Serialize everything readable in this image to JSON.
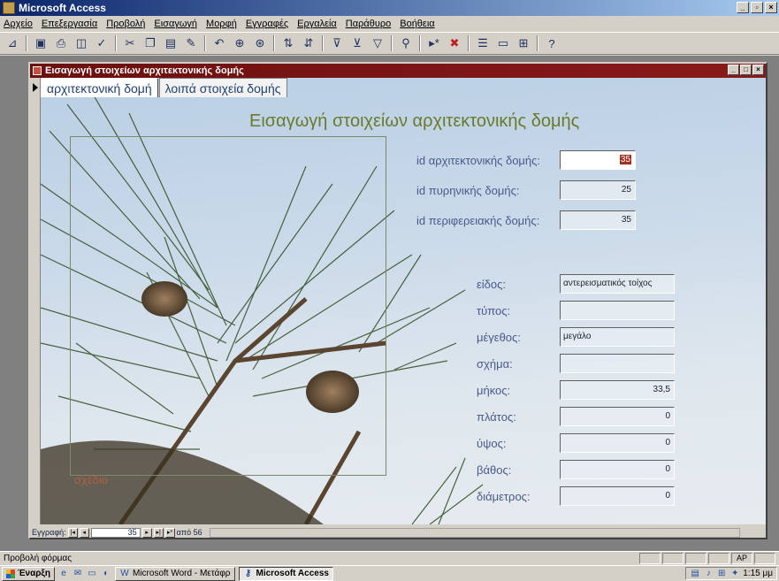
{
  "app": {
    "title": "Microsoft Access"
  },
  "menubar": [
    "Αρχείο",
    "Επεξεργασία",
    "Προβολή",
    "Εισαγωγή",
    "Μορφή",
    "Εγγραφές",
    "Εργαλεία",
    "Παράθυρο",
    "Βοήθεια"
  ],
  "toolbar": {
    "icons": [
      "view-icon",
      "save-icon",
      "print-icon",
      "print-preview-icon",
      "spelling-icon",
      "cut-icon",
      "copy-icon",
      "paste-icon",
      "format-painter-icon",
      "undo-icon",
      "insert-hyperlink-icon",
      "web-toolbar-icon",
      "sort-ascending-icon",
      "sort-descending-icon",
      "filter-by-selection-icon",
      "filter-by-form-icon",
      "apply-filter-icon",
      "find-icon",
      "new-record-icon",
      "delete-record-icon",
      "properties-icon",
      "database-window-icon",
      "new-object-icon",
      "help-icon"
    ]
  },
  "form_window": {
    "title": "Εισαγωγή στοιχείων αρχιτεκτονικής δομής"
  },
  "tabs": [
    "αρχιτεκτονική δομή",
    "λοιπά στοιχεία δομής"
  ],
  "form": {
    "heading": "Εισαγωγή στοιχείων αρχιτεκτονικής δομής",
    "frame_caption": "σχέδιο",
    "ids": [
      {
        "label": "id αρχιτεκτονικής δομής:",
        "value": "35"
      },
      {
        "label": "id πυρηνικής δομής:",
        "value": "25"
      },
      {
        "label": "id περιφερειακής δομής:",
        "value": "35"
      }
    ],
    "fields": [
      {
        "label": "είδος:",
        "value": "αντερεισματικός τοίχος"
      },
      {
        "label": "τύπος:",
        "value": ""
      },
      {
        "label": "μέγεθος:",
        "value": "μεγάλο"
      },
      {
        "label": "σχήμα:",
        "value": ""
      },
      {
        "label": "μήκος:",
        "value": "33,5"
      },
      {
        "label": "πλάτος:",
        "value": "0"
      },
      {
        "label": "ύψος:",
        "value": "0"
      },
      {
        "label": "βάθος:",
        "value": "0"
      },
      {
        "label": "διάμετρος:",
        "value": "0"
      }
    ]
  },
  "record_nav": {
    "label": "Εγγραφή:",
    "current": "35",
    "of_label": "από 56"
  },
  "statusbar": {
    "text": "Προβολή φόρμας",
    "indicator": "ΑΡ"
  },
  "taskbar": {
    "start": "Έναρξη",
    "buttons": [
      "Microsoft Word - Μετάφρ",
      "Microsoft Access"
    ],
    "clock": "1:15 μμ"
  }
}
